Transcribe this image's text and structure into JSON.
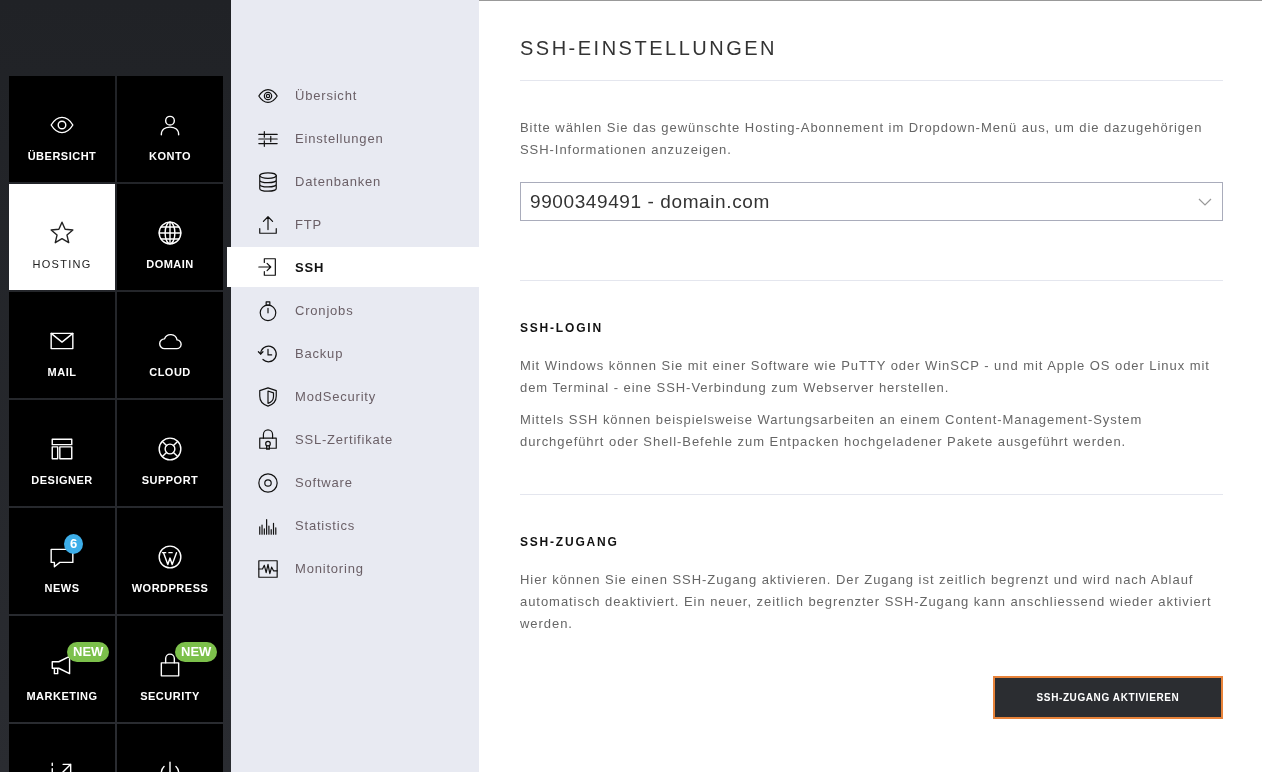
{
  "tiles": [
    {
      "label": "ÜBERSICHT",
      "selected": false
    },
    {
      "label": "KONTO",
      "selected": false
    },
    {
      "label": "HOSTING",
      "selected": true
    },
    {
      "label": "DOMAIN",
      "selected": false
    },
    {
      "label": "MAIL",
      "selected": false
    },
    {
      "label": "CLOUD",
      "selected": false
    },
    {
      "label": "DESIGNER",
      "selected": false
    },
    {
      "label": "SUPPORT",
      "selected": false
    },
    {
      "label": "NEWS",
      "selected": false,
      "badge": {
        "kind": "count",
        "text": "6"
      }
    },
    {
      "label": "WORDPRESS",
      "selected": false
    },
    {
      "label": "MARKETING",
      "selected": false,
      "badge": {
        "kind": "new",
        "text": "NEW"
      }
    },
    {
      "label": "SECURITY",
      "selected": false,
      "badge": {
        "kind": "new",
        "text": "NEW"
      }
    },
    {
      "selected": false
    },
    {
      "selected": false
    }
  ],
  "subnav": [
    {
      "label": "Übersicht",
      "selected": false
    },
    {
      "label": "Einstellungen",
      "selected": false
    },
    {
      "label": "Datenbanken",
      "selected": false
    },
    {
      "label": "FTP",
      "selected": false
    },
    {
      "label": "SSH",
      "selected": true
    },
    {
      "label": "Cronjobs",
      "selected": false
    },
    {
      "label": "Backup",
      "selected": false
    },
    {
      "label": "ModSecurity",
      "selected": false
    },
    {
      "label": "SSL-Zertifikate",
      "selected": false
    },
    {
      "label": "Software",
      "selected": false
    },
    {
      "label": "Statistics",
      "selected": false
    },
    {
      "label": "Monitoring",
      "selected": false
    }
  ],
  "main": {
    "title": "SSH-EINSTELLUNGEN",
    "intro": "Bitte wählen Sie das gewünschte Hosting-Abonnement im Dropdown-Menü aus, um die dazugehörigen SSH-Informationen anzuzeigen.",
    "subscription_select": {
      "value": "9900349491 - domain.com"
    },
    "sections": [
      {
        "heading": "SSH-LOGIN",
        "paragraphs": [
          "Mit Windows können Sie mit einer Software wie PuTTY oder WinSCP - und mit Apple OS oder Linux mit dem Terminal - eine SSH-Verbindung zum Webserver herstellen.",
          "Mittels SSH können beispielsweise Wartungsarbeiten an einem Content-Management-System durchgeführt oder Shell-Befehle zum Entpacken hochgeladener Pakete ausgeführt werden."
        ]
      },
      {
        "heading": "SSH-ZUGANG",
        "paragraphs": [
          "Hier können Sie einen SSH-Zugang aktivieren. Der Zugang ist zeitlich begrenzt und wird nach Ablauf automatisch deaktiviert. Ein neuer, zeitlich begrenzter SSH-Zugang kann anschliessend wieder aktiviert werden."
        ]
      }
    ],
    "button": "SSH-ZUGANG AKTIVIEREN"
  }
}
